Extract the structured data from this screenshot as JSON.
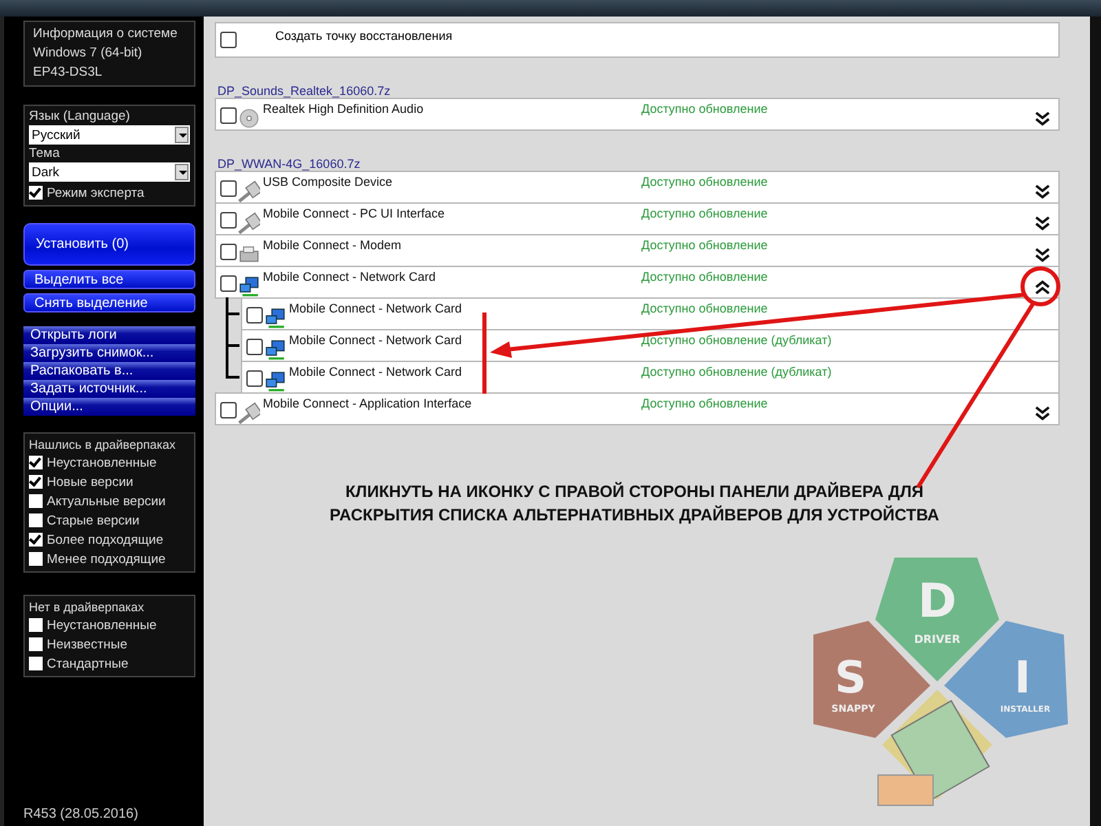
{
  "sidebar": {
    "system_info": [
      "Информация о системе",
      "Windows 7 (64-bit)",
      "EP43-DS3L"
    ],
    "language": {
      "label": "Язык (Language)",
      "value": "Русский"
    },
    "theme": {
      "label": "Тема",
      "value": "Dark"
    },
    "expert_mode": {
      "label": "Режим эксперта",
      "checked": true
    },
    "install_button": "Установить (0)",
    "select_buttons": [
      "Выделить все",
      "Снять выделение"
    ],
    "menu": [
      "Открыть логи",
      "Загрузить снимок...",
      "Распаковать в...",
      "Задать источник...",
      "Опции..."
    ],
    "filter_groups": [
      {
        "title": "Нашлись в драйверпаках",
        "items": [
          {
            "label": "Неустановленные",
            "checked": true
          },
          {
            "label": "Новые версии",
            "checked": true
          },
          {
            "label": "Актуальные версии",
            "checked": false
          },
          {
            "label": "Старые версии",
            "checked": false
          },
          {
            "label": "Более подходящие",
            "checked": true
          },
          {
            "label": "Менее подходящие",
            "checked": false
          }
        ]
      },
      {
        "title": "Нет в драйверпаках",
        "items": [
          {
            "label": "Неустановленные",
            "checked": false
          },
          {
            "label": "Неизвестные",
            "checked": false
          },
          {
            "label": "Стандартные",
            "checked": false
          }
        ]
      }
    ],
    "version": "R453 (28.05.2016)"
  },
  "restore_point": {
    "label": "Создать точку восстановления",
    "checked": false
  },
  "packs": [
    {
      "name": "DP_Sounds_Realtek_16060.7z",
      "devices": [
        {
          "name": "Realtek High Definition Audio",
          "status": "Доступно обновление",
          "kind": "disc",
          "checked": false,
          "expanded": false
        }
      ]
    },
    {
      "name": "DP_WWAN-4G_16060.7z",
      "devices": [
        {
          "name": "USB Composite Device",
          "status": "Доступно обновление",
          "kind": "plug",
          "checked": false,
          "expanded": false
        },
        {
          "name": "Mobile Connect - PC UI Interface",
          "status": "Доступно обновление",
          "kind": "plug",
          "checked": false,
          "expanded": false
        },
        {
          "name": "Mobile Connect - Modem",
          "status": "Доступно обновление",
          "kind": "fax",
          "checked": false,
          "expanded": false
        },
        {
          "name": "Mobile Connect - Network Card",
          "status": "Доступно обновление",
          "kind": "network",
          "checked": false,
          "expanded": true,
          "children": [
            {
              "name": "Mobile Connect - Network Card",
              "status": "Доступно обновление",
              "kind": "network",
              "checked": false
            },
            {
              "name": "Mobile Connect - Network Card",
              "status": "Доступно обновление (дубликат)",
              "kind": "network",
              "checked": false
            },
            {
              "name": "Mobile Connect - Network Card",
              "status": "Доступно обновление (дубликат)",
              "kind": "network",
              "checked": false
            }
          ]
        },
        {
          "name": "Mobile Connect - Application Interface",
          "status": "Доступно обновление",
          "kind": "plug",
          "checked": false,
          "expanded": false
        }
      ]
    }
  ],
  "annotation": "КЛИКНУТЬ НА ИКОНКУ С ПРАВОЙ СТОРОНЫ ПАНЕЛИ ДРАЙВЕРА ДЛЯ РАСКРЫТИЯ СПИСКА АЛЬТЕРНАТИВНЫХ ДРАЙВЕРОВ ДЛЯ УСТРОЙСТВА",
  "logo": [
    {
      "letter": "D",
      "word": "DRIVER",
      "color": "#6fb88a"
    },
    {
      "letter": "S",
      "word": "SNAPPY",
      "color": "#b07a6a"
    },
    {
      "letter": "I",
      "word": "INSTALLER",
      "color": "#6f9ec8"
    }
  ]
}
